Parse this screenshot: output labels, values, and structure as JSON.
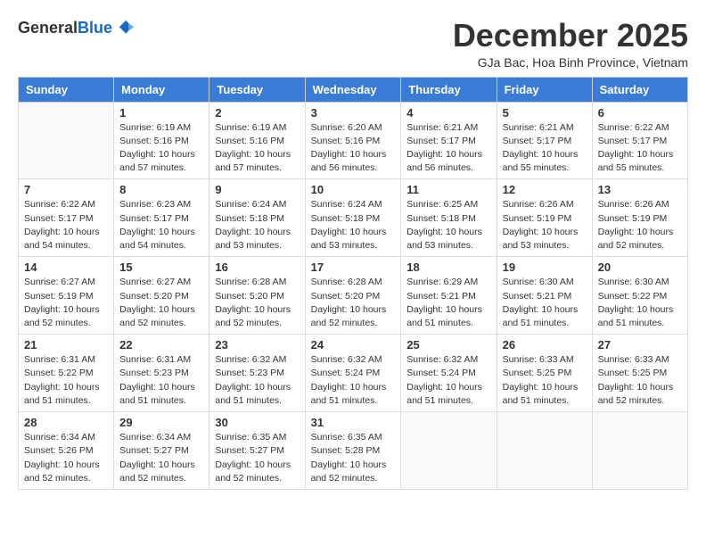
{
  "logo": {
    "general": "General",
    "blue": "Blue"
  },
  "title": "December 2025",
  "subtitle": "GJa Bac, Hoa Binh Province, Vietnam",
  "headers": [
    "Sunday",
    "Monday",
    "Tuesday",
    "Wednesday",
    "Thursday",
    "Friday",
    "Saturday"
  ],
  "weeks": [
    [
      {
        "day": "",
        "info": ""
      },
      {
        "day": "1",
        "info": "Sunrise: 6:19 AM\nSunset: 5:16 PM\nDaylight: 10 hours\nand 57 minutes."
      },
      {
        "day": "2",
        "info": "Sunrise: 6:19 AM\nSunset: 5:16 PM\nDaylight: 10 hours\nand 57 minutes."
      },
      {
        "day": "3",
        "info": "Sunrise: 6:20 AM\nSunset: 5:16 PM\nDaylight: 10 hours\nand 56 minutes."
      },
      {
        "day": "4",
        "info": "Sunrise: 6:21 AM\nSunset: 5:17 PM\nDaylight: 10 hours\nand 56 minutes."
      },
      {
        "day": "5",
        "info": "Sunrise: 6:21 AM\nSunset: 5:17 PM\nDaylight: 10 hours\nand 55 minutes."
      },
      {
        "day": "6",
        "info": "Sunrise: 6:22 AM\nSunset: 5:17 PM\nDaylight: 10 hours\nand 55 minutes."
      }
    ],
    [
      {
        "day": "7",
        "info": "Sunrise: 6:22 AM\nSunset: 5:17 PM\nDaylight: 10 hours\nand 54 minutes."
      },
      {
        "day": "8",
        "info": "Sunrise: 6:23 AM\nSunset: 5:17 PM\nDaylight: 10 hours\nand 54 minutes."
      },
      {
        "day": "9",
        "info": "Sunrise: 6:24 AM\nSunset: 5:18 PM\nDaylight: 10 hours\nand 53 minutes."
      },
      {
        "day": "10",
        "info": "Sunrise: 6:24 AM\nSunset: 5:18 PM\nDaylight: 10 hours\nand 53 minutes."
      },
      {
        "day": "11",
        "info": "Sunrise: 6:25 AM\nSunset: 5:18 PM\nDaylight: 10 hours\nand 53 minutes."
      },
      {
        "day": "12",
        "info": "Sunrise: 6:26 AM\nSunset: 5:19 PM\nDaylight: 10 hours\nand 53 minutes."
      },
      {
        "day": "13",
        "info": "Sunrise: 6:26 AM\nSunset: 5:19 PM\nDaylight: 10 hours\nand 52 minutes."
      }
    ],
    [
      {
        "day": "14",
        "info": "Sunrise: 6:27 AM\nSunset: 5:19 PM\nDaylight: 10 hours\nand 52 minutes."
      },
      {
        "day": "15",
        "info": "Sunrise: 6:27 AM\nSunset: 5:20 PM\nDaylight: 10 hours\nand 52 minutes."
      },
      {
        "day": "16",
        "info": "Sunrise: 6:28 AM\nSunset: 5:20 PM\nDaylight: 10 hours\nand 52 minutes."
      },
      {
        "day": "17",
        "info": "Sunrise: 6:28 AM\nSunset: 5:20 PM\nDaylight: 10 hours\nand 52 minutes."
      },
      {
        "day": "18",
        "info": "Sunrise: 6:29 AM\nSunset: 5:21 PM\nDaylight: 10 hours\nand 51 minutes."
      },
      {
        "day": "19",
        "info": "Sunrise: 6:30 AM\nSunset: 5:21 PM\nDaylight: 10 hours\nand 51 minutes."
      },
      {
        "day": "20",
        "info": "Sunrise: 6:30 AM\nSunset: 5:22 PM\nDaylight: 10 hours\nand 51 minutes."
      }
    ],
    [
      {
        "day": "21",
        "info": "Sunrise: 6:31 AM\nSunset: 5:22 PM\nDaylight: 10 hours\nand 51 minutes."
      },
      {
        "day": "22",
        "info": "Sunrise: 6:31 AM\nSunset: 5:23 PM\nDaylight: 10 hours\nand 51 minutes."
      },
      {
        "day": "23",
        "info": "Sunrise: 6:32 AM\nSunset: 5:23 PM\nDaylight: 10 hours\nand 51 minutes."
      },
      {
        "day": "24",
        "info": "Sunrise: 6:32 AM\nSunset: 5:24 PM\nDaylight: 10 hours\nand 51 minutes."
      },
      {
        "day": "25",
        "info": "Sunrise: 6:32 AM\nSunset: 5:24 PM\nDaylight: 10 hours\nand 51 minutes."
      },
      {
        "day": "26",
        "info": "Sunrise: 6:33 AM\nSunset: 5:25 PM\nDaylight: 10 hours\nand 51 minutes."
      },
      {
        "day": "27",
        "info": "Sunrise: 6:33 AM\nSunset: 5:25 PM\nDaylight: 10 hours\nand 52 minutes."
      }
    ],
    [
      {
        "day": "28",
        "info": "Sunrise: 6:34 AM\nSunset: 5:26 PM\nDaylight: 10 hours\nand 52 minutes."
      },
      {
        "day": "29",
        "info": "Sunrise: 6:34 AM\nSunset: 5:27 PM\nDaylight: 10 hours\nand 52 minutes."
      },
      {
        "day": "30",
        "info": "Sunrise: 6:35 AM\nSunset: 5:27 PM\nDaylight: 10 hours\nand 52 minutes."
      },
      {
        "day": "31",
        "info": "Sunrise: 6:35 AM\nSunset: 5:28 PM\nDaylight: 10 hours\nand 52 minutes."
      },
      {
        "day": "",
        "info": ""
      },
      {
        "day": "",
        "info": ""
      },
      {
        "day": "",
        "info": ""
      }
    ]
  ]
}
